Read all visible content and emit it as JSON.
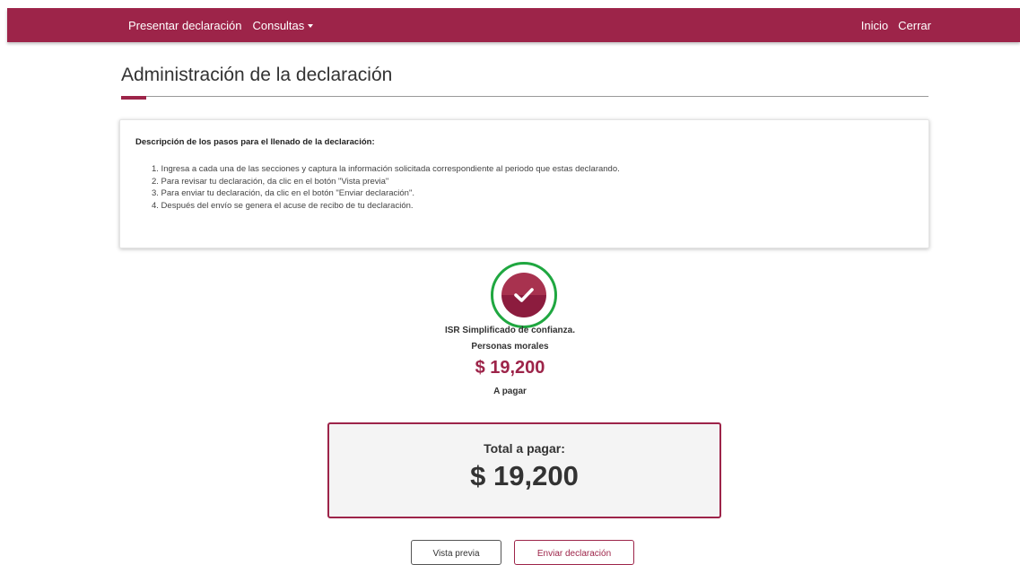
{
  "nav": {
    "present_label": "Presentar declaración",
    "queries_label": "Consultas",
    "home_label": "Inicio",
    "close_label": "Cerrar"
  },
  "page": {
    "title": "Administración de la declaración"
  },
  "instructions": {
    "heading": "Descripción de los pasos para el llenado de la declaración:",
    "steps": [
      "1. Ingresa a cada una de las secciones y captura la información solicitada correspondiente al periodo que estas declarando.",
      "2. Para revisar tu declaración, da clic en el botón \"Vista previa\"",
      "3. Para enviar tu declaración, da clic en el botón \"Enviar declaración\".",
      "4. Después del envío se genera el acuse de recibo de tu declaración."
    ]
  },
  "section": {
    "icon": "check-icon",
    "name": "ISR Simplificado de confianza.",
    "subtitle": "Personas morales",
    "amount": "$ 19,200",
    "status": "A pagar"
  },
  "total": {
    "label": "Total a pagar:",
    "amount": "$ 19,200"
  },
  "actions": {
    "preview_label": "Vista previa",
    "send_label": "Enviar declaración"
  },
  "colors": {
    "brand": "#9d2449",
    "complete_ring": "#1fa740"
  }
}
